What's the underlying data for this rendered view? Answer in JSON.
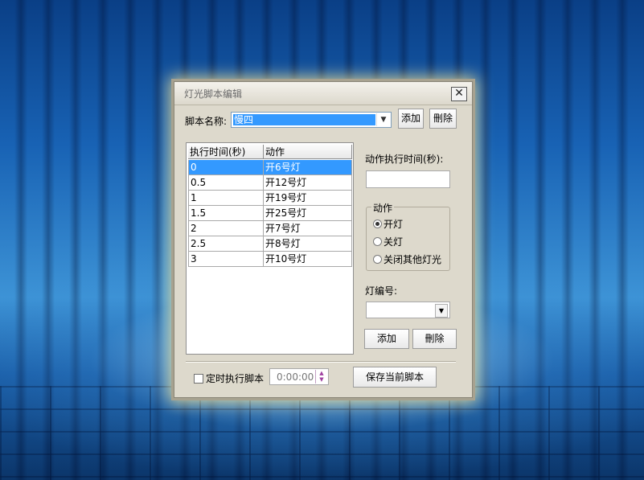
{
  "window": {
    "title": "灯光脚本编辑",
    "close_glyph": "✕"
  },
  "script": {
    "name_label": "脚本名称:",
    "name_value": "慢四",
    "add_label": "添加",
    "delete_label": "刪除"
  },
  "table": {
    "columns": [
      "执行时间(秒)",
      "动作"
    ],
    "rows": [
      [
        "0",
        "开6号灯"
      ],
      [
        "0.5",
        "开12号灯"
      ],
      [
        "1",
        "开19号灯"
      ],
      [
        "1.5",
        "开25号灯"
      ],
      [
        "2",
        "开7号灯"
      ],
      [
        "2.5",
        "开8号灯"
      ],
      [
        "3",
        "开10号灯"
      ]
    ],
    "selected_row": 0
  },
  "action_panel": {
    "time_label": "动作执行时间(秒):",
    "time_value": "",
    "group_title": "动作",
    "options": [
      "开灯",
      "关灯",
      "关闭其他灯光"
    ],
    "selected_option": 0,
    "lamp_label": "灯编号:",
    "lamp_value": "",
    "add_label": "添加",
    "delete_label": "刪除"
  },
  "footer": {
    "timer_checkbox_label": "定时执行脚本",
    "timer_checked": false,
    "time_value": "0:00:00",
    "save_label": "保存当前脚本"
  },
  "icons": {
    "dropdown": "chevron-down-icon",
    "spinner": "spinner-arrows-icon"
  },
  "colors": {
    "selection": "#3399ff",
    "dialog_bg": "#ddd9cc"
  }
}
